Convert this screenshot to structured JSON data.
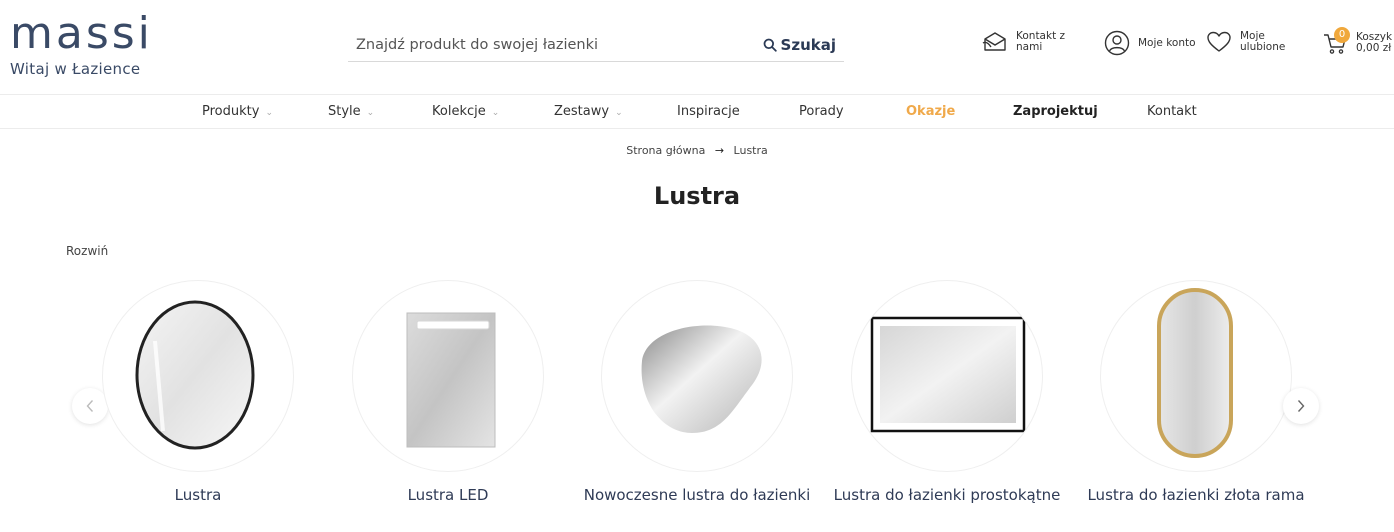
{
  "header": {
    "logo_word": "massi",
    "logo_tagline": "Witaj w Łazience",
    "search_placeholder": "Znajdź produkt do swojej łazienki",
    "search_button": "Szukaj",
    "contact_label": "Kontakt z nami",
    "account_label": "Moje konto",
    "favorites_label": "Moje ulubione",
    "cart_label": "Koszyk",
    "cart_value": "0,00 zł",
    "cart_count": "0"
  },
  "nav": {
    "items": [
      {
        "label": "Produkty"
      },
      {
        "label": "Style"
      },
      {
        "label": "Kolekcje"
      },
      {
        "label": "Zestawy"
      },
      {
        "label": "Inspiracje"
      },
      {
        "label": "Porady"
      },
      {
        "label": "Okazje"
      },
      {
        "label": "Zaprojektuj"
      },
      {
        "label": "Kontakt"
      }
    ]
  },
  "breadcrumb": {
    "home": "Strona główna",
    "current": "Lustra"
  },
  "page": {
    "title": "Lustra",
    "expand": "Rozwiń"
  },
  "categories": [
    {
      "label": "Lustra"
    },
    {
      "label": "Lustra LED"
    },
    {
      "label": "Nowoczesne lustra do łazienki"
    },
    {
      "label": "Lustra do łazienki prostokątne"
    },
    {
      "label": "Lustra do łazienki złota rama"
    }
  ],
  "colors": {
    "brand": "#3a4a66",
    "accent": "#f0a94a",
    "gold": "#c9a55a"
  }
}
